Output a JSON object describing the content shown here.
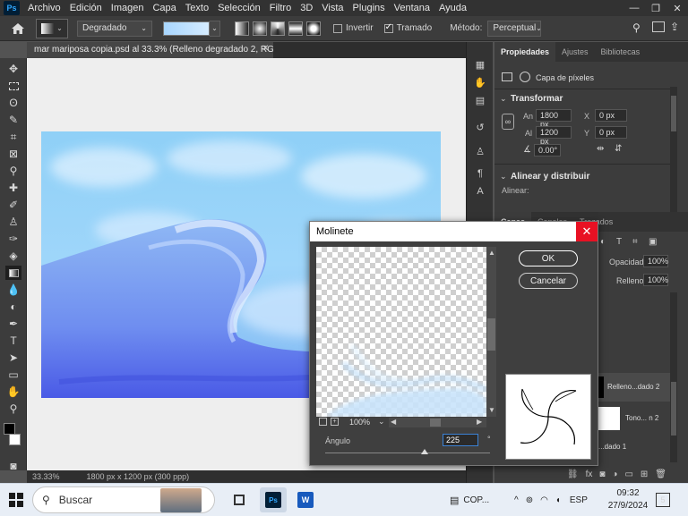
{
  "app": {
    "logo": "Ps",
    "menu": [
      "Archivo",
      "Edición",
      "Imagen",
      "Capa",
      "Texto",
      "Selección",
      "Filtro",
      "3D",
      "Vista",
      "Plugins",
      "Ventana",
      "Ayuda"
    ]
  },
  "options": {
    "preset": "Degradado",
    "invert_label": "Invertir",
    "invert_checked": false,
    "dither_label": "Tramado",
    "dither_checked": true,
    "method_label": "Método:",
    "method_value": "Perceptual"
  },
  "document": {
    "tab_title": "mar mariposa copia.psd al 33.3% (Relleno degradado 2, RGB/8) *",
    "zoom": "33.33%",
    "size_info": "1800 px x 1200 px (300 ppp)"
  },
  "properties": {
    "tabs": [
      "Propiedades",
      "Ajustes",
      "Bibliotecas"
    ],
    "layer_type": "Capa de píxeles",
    "transform_title": "Transformar",
    "an_label": "An",
    "an_value": "1800 px",
    "al_label": "Al",
    "al_value": "1200 px",
    "x_label": "X",
    "x_value": "0 px",
    "y_label": "Y",
    "y_value": "0 px",
    "angle_value": "0.00°",
    "align_title": "Alinear y distribuir",
    "align_label": "Alinear:"
  },
  "layers": {
    "tabs": [
      "Capas",
      "Canales",
      "Trazados"
    ],
    "opacity_label": "Opacidad:",
    "opacity_value": "100%",
    "fill_label": "Relleno:",
    "fill_value": "100%",
    "items": [
      "Relleno...dado 2",
      "Tono... n 2",
      "...dado 1"
    ]
  },
  "dialog": {
    "title": "Molinete",
    "ok_label": "OK",
    "cancel_label": "Cancelar",
    "zoom": "100%",
    "angle_label": "Ángulo",
    "angle_value": "225",
    "angle_unit": "°"
  },
  "taskbar": {
    "search_placeholder": "Buscar",
    "copilot_label": "COP...",
    "lang": "ESP",
    "time": "09:32",
    "date": "27/9/2024",
    "notifications": "5"
  }
}
